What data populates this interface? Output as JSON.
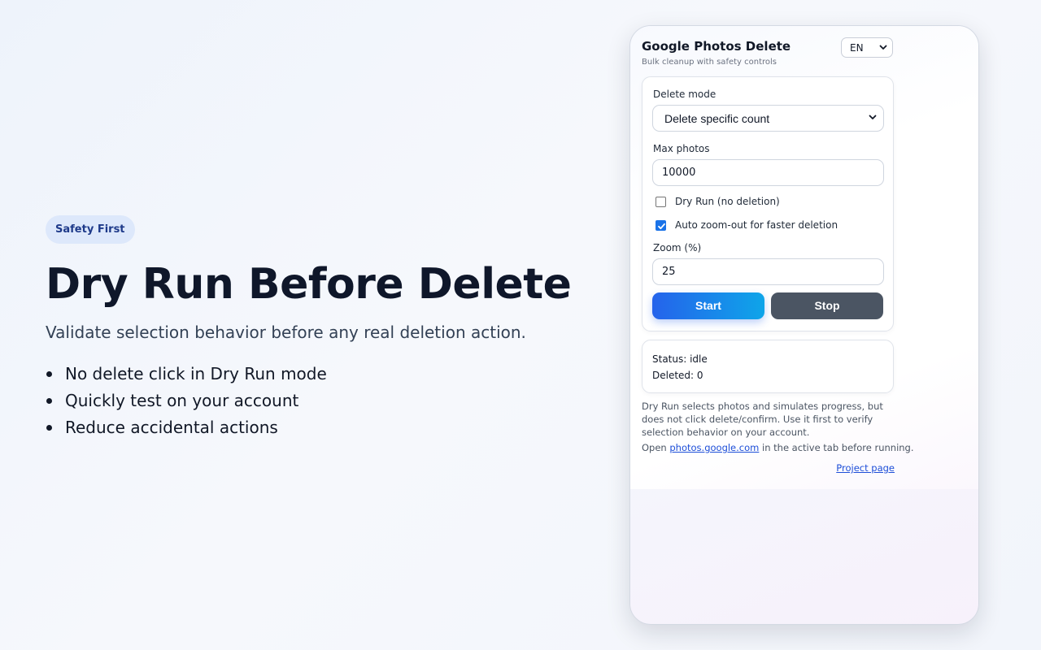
{
  "hero": {
    "badge": "Safety First",
    "title": "Dry Run Before Delete",
    "subtitle": "Validate selection behavior before any real deletion action.",
    "bullets": [
      "No delete click in Dry Run mode",
      "Quickly test on your account",
      "Reduce accidental actions"
    ]
  },
  "popup": {
    "title": "Google Photos Delete",
    "subtitle": "Bulk cleanup with safety controls",
    "language": "EN",
    "delete_mode": {
      "label": "Delete mode",
      "value": "Delete specific count"
    },
    "max_photos": {
      "label": "Max photos",
      "value": "10000"
    },
    "dry_run": {
      "label": "Dry Run (no deletion)",
      "checked": false
    },
    "auto_zoom": {
      "label": "Auto zoom-out for faster deletion",
      "checked": true
    },
    "zoom": {
      "label": "Zoom (%)",
      "value": "25"
    },
    "start_label": "Start",
    "stop_label": "Stop",
    "status": {
      "status_text": "Status: idle",
      "deleted_text": "Deleted: 0"
    },
    "note": "Dry Run selects photos and simulates progress, but does not click delete/confirm. Use it first to verify selection behavior on your account.",
    "open_prefix": "Open",
    "open_link": "photos.google.com",
    "open_suffix": "in the active tab before running.",
    "project_link": "Project page"
  },
  "colors": {
    "accent": "#2563eb",
    "accent_end": "#0ea5e9",
    "stop": "#4b5563",
    "badge_bg": "#dde8fb",
    "badge_text": "#1e3a8a"
  },
  "icons": {
    "lang_chevron": "chevron-down-icon",
    "mode_chevron": "chevron-down-icon",
    "check": "check-icon"
  }
}
